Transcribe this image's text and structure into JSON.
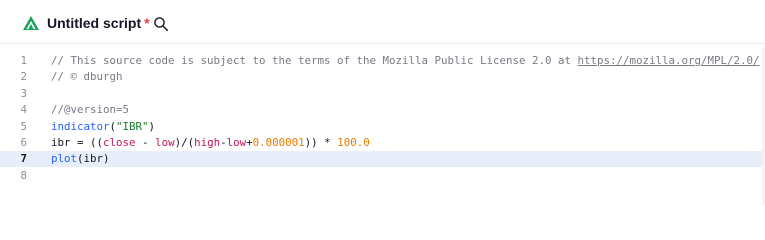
{
  "header": {
    "title": "Untitled script",
    "unsaved_marker": "*",
    "logo_icon": "pine-logo-icon",
    "search_icon": "search-icon",
    "accent_color": "#1aa35a"
  },
  "editor": {
    "current_line": 7,
    "lines": [
      {
        "number": "1",
        "tokens": [
          {
            "t": "comment",
            "v": "// This source code is subject to the terms of the Mozilla Public License 2.0 at "
          },
          {
            "t": "link",
            "v": "https://mozilla.org/MPL/2.0/"
          }
        ]
      },
      {
        "number": "2",
        "tokens": [
          {
            "t": "comment",
            "v": "// © dburgh"
          }
        ]
      },
      {
        "number": "3",
        "tokens": []
      },
      {
        "number": "4",
        "tokens": [
          {
            "t": "comment",
            "v": "//@version=5"
          }
        ]
      },
      {
        "number": "5",
        "tokens": [
          {
            "t": "func",
            "v": "indicator"
          },
          {
            "t": "op",
            "v": "("
          },
          {
            "t": "string",
            "v": "\"IBR\""
          },
          {
            "t": "op",
            "v": ")"
          }
        ]
      },
      {
        "number": "6",
        "tokens": [
          {
            "t": "var",
            "v": "ibr"
          },
          {
            "t": "op",
            "v": " = (("
          },
          {
            "t": "builtin",
            "v": "close"
          },
          {
            "t": "op",
            "v": " - "
          },
          {
            "t": "builtin",
            "v": "low"
          },
          {
            "t": "op",
            "v": ")/("
          },
          {
            "t": "builtin",
            "v": "high"
          },
          {
            "t": "op",
            "v": "-"
          },
          {
            "t": "builtin",
            "v": "low"
          },
          {
            "t": "op",
            "v": "+"
          },
          {
            "t": "number",
            "v": "0.000001"
          },
          {
            "t": "op",
            "v": ")) * "
          },
          {
            "t": "number",
            "v": "100.0"
          }
        ]
      },
      {
        "number": "7",
        "tokens": [
          {
            "t": "func",
            "v": "plot"
          },
          {
            "t": "op",
            "v": "("
          },
          {
            "t": "var",
            "v": "ibr"
          },
          {
            "t": "op",
            "v": ")"
          }
        ]
      },
      {
        "number": "8",
        "tokens": []
      }
    ]
  }
}
